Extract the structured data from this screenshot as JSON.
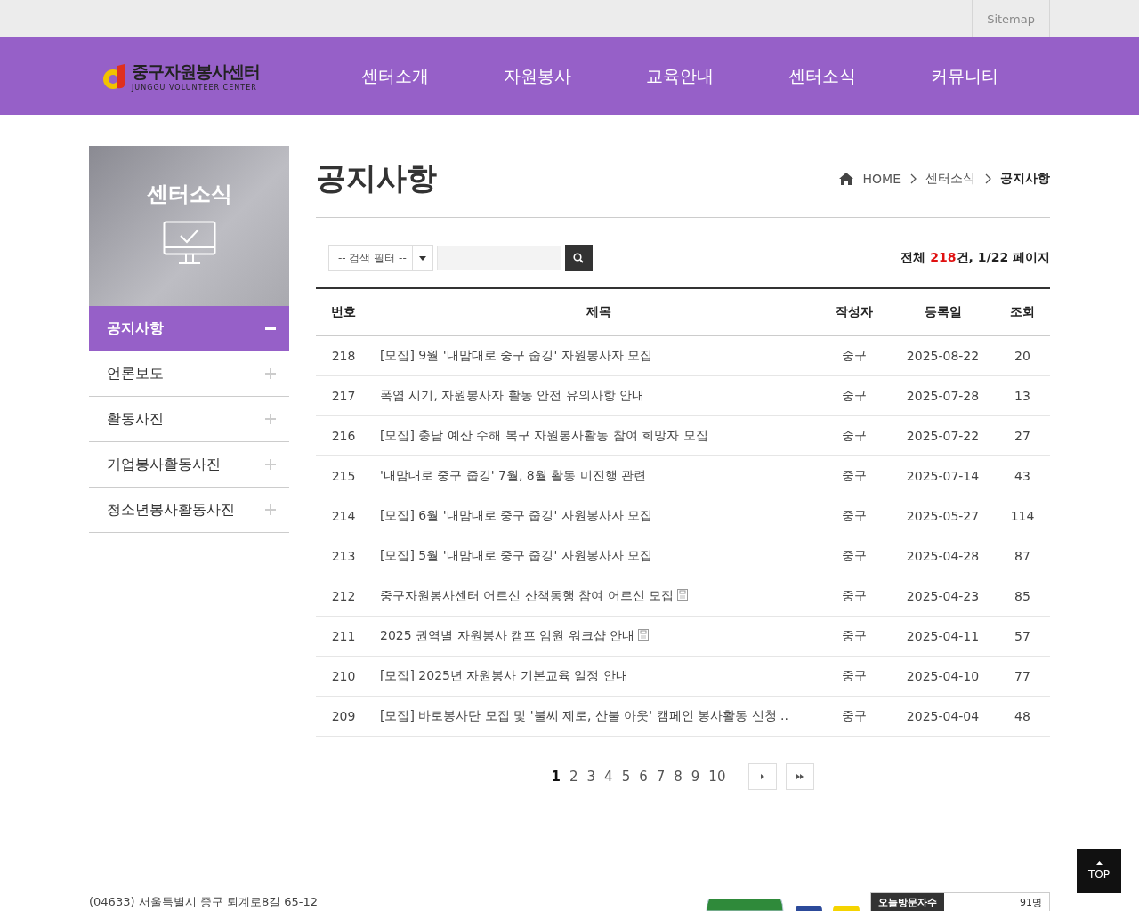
{
  "top_bar": {
    "sitemap": "Sitemap"
  },
  "logo": {
    "name": "중구자원봉사센터",
    "english": "JUNGGU VOLUNTEER CENTER"
  },
  "nav": [
    "센터소개",
    "자원봉사",
    "교육안내",
    "센터소식",
    "커뮤니티"
  ],
  "sidebar": {
    "title": "센터소식",
    "items": [
      {
        "label": "공지사항",
        "selected": true
      },
      {
        "label": "언론보도",
        "selected": false
      },
      {
        "label": "활동사진",
        "selected": false
      },
      {
        "label": "기업봉사활동사진",
        "selected": false
      },
      {
        "label": "청소년봉사활동사진",
        "selected": false
      }
    ]
  },
  "page_title": "공지사항",
  "breadcrumb": [
    "HOME",
    "센터소식",
    "공지사항"
  ],
  "search": {
    "filter": "-- 검색 필터 --"
  },
  "summary": {
    "prefix": "전체 ",
    "count": "218",
    "suffix": "건, 1/22 페이지"
  },
  "table": {
    "columns": [
      "번호",
      "제목",
      "작성자",
      "등록일",
      "조회"
    ],
    "rows": [
      {
        "no": "218",
        "title": "[모집] 9월 '내맘대로 중구 줍깅' 자원봉사자 모집",
        "author": "중구",
        "date": "2025-08-22",
        "views": "20",
        "attachment": false
      },
      {
        "no": "217",
        "title": "폭염 시기, 자원봉사자 활동 안전 유의사항 안내",
        "author": "중구",
        "date": "2025-07-28",
        "views": "13",
        "attachment": false
      },
      {
        "no": "216",
        "title": "[모집] 충남 예산 수해 복구 자원봉사활동 참여 희망자 모집",
        "author": "중구",
        "date": "2025-07-22",
        "views": "27",
        "attachment": false
      },
      {
        "no": "215",
        "title": "'내맘대로 중구 줍깅' 7월, 8월 활동 미진행 관련",
        "author": "중구",
        "date": "2025-07-14",
        "views": "43",
        "attachment": false
      },
      {
        "no": "214",
        "title": "[모집] 6월 '내맘대로 중구 줍깅' 자원봉사자 모집",
        "author": "중구",
        "date": "2025-05-27",
        "views": "114",
        "attachment": false
      },
      {
        "no": "213",
        "title": "[모집] 5월 '내맘대로 중구 줍깅' 자원봉사자 모집",
        "author": "중구",
        "date": "2025-04-28",
        "views": "87",
        "attachment": false
      },
      {
        "no": "212",
        "title": "중구자원봉사센터 어르신 산책동행 참여 어르신 모집",
        "author": "중구",
        "date": "2025-04-23",
        "views": "85",
        "attachment": true
      },
      {
        "no": "211",
        "title": "2025 권역별 자원봉사 캠프 임원 워크샵 안내",
        "author": "중구",
        "date": "2025-04-11",
        "views": "57",
        "attachment": true
      },
      {
        "no": "210",
        "title": "[모집] 2025년 자원봉사 기본교육 일정 안내",
        "author": "중구",
        "date": "2025-04-10",
        "views": "77",
        "attachment": false
      },
      {
        "no": "209",
        "title": "[모집] 바로봉사단 모집 및 '불씨 제로, 산불 아웃' 캠페인 봉사활동 신청 ..",
        "author": "중구",
        "date": "2025-04-04",
        "views": "48",
        "attachment": false
      }
    ]
  },
  "pagination": [
    {
      "label": "1",
      "selected": true
    },
    {
      "label": "2",
      "selected": false
    },
    {
      "label": "3",
      "selected": false
    },
    {
      "label": "4",
      "selected": false
    },
    {
      "label": "5",
      "selected": false
    },
    {
      "label": "6",
      "selected": false
    },
    {
      "label": "7",
      "selected": false
    },
    {
      "label": "8",
      "selected": false
    },
    {
      "label": "9",
      "selected": false
    },
    {
      "label": "10",
      "selected": false
    }
  ],
  "top_button": "TOP",
  "footer": {
    "address": "(04633) 서울특별시 중구 퇴계로8길 65-12",
    "visitor_label": "오늘방문자수",
    "visitor_count": "91명"
  }
}
